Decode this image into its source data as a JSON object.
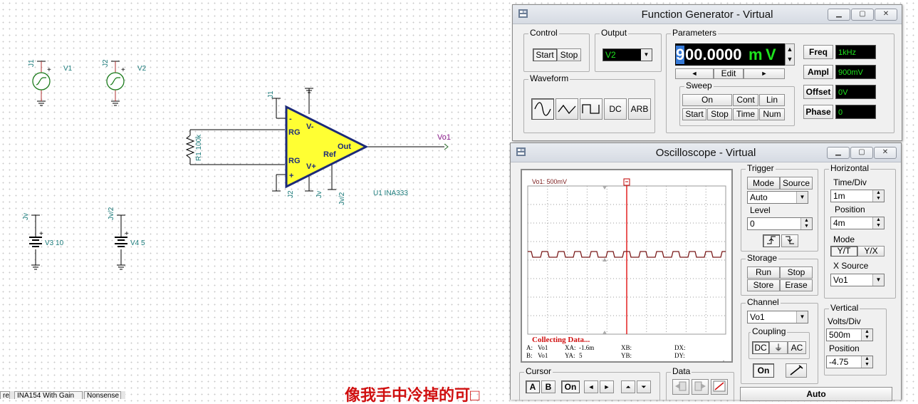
{
  "schematic": {
    "sources": {
      "v1_net": "J1",
      "v1_name": "V1",
      "v2_net": "J2",
      "v2_name": "V2",
      "v3_net": "Jv",
      "v3_name": "V3 10",
      "v4_net": "Jv/2",
      "v4_name": "V4 5"
    },
    "resistor_label": "R1 100k",
    "opamp": {
      "pin_minus": "-",
      "pin_plus": "+",
      "rg_top": "RG",
      "rg_bottom": "RG",
      "vminus": "V-",
      "vplus": "V+",
      "out": "Out",
      "ref": "Ref",
      "top_net": "J1",
      "bottom_net_left": "J2",
      "bottom_net_mid": "Jv",
      "bottom_net_right": "Jv/2",
      "name": "U1 INA333"
    },
    "output_label": "Vo1",
    "plus_sign": "+"
  },
  "function_generator": {
    "title": "Function Generator - Virtual",
    "control_label": "Control",
    "start": "Start",
    "stop": "Stop",
    "output_label": "Output",
    "output_value": "V2",
    "waveform_label": "Waveform",
    "wave_dc": "DC",
    "wave_arb": "ARB",
    "parameters_label": "Parameters",
    "value_first": "9",
    "value_rest": "00.0000",
    "unit_prefix": "m",
    "unit": "V",
    "left_arrow": "◄",
    "edit": "Edit",
    "right_arrow": "►",
    "sweep_label": "Sweep",
    "sweep_on": "On",
    "sweep_cont": "Cont",
    "sweep_lin": "Lin",
    "sweep_start": "Start",
    "sweep_stop": "Stop",
    "sweep_time": "Time",
    "sweep_num": "Num",
    "freq_label": "Freq",
    "freq_value": "1kHz",
    "ampl_label": "Ampl",
    "ampl_value": "900mV",
    "offset_label": "Offset",
    "offset_value": "0V",
    "phase_label": "Phase",
    "phase_value": "0"
  },
  "oscilloscope": {
    "title": "Oscilloscope - Virtual",
    "screen": {
      "channel_label": "Vo1: 500mV",
      "status": "Collecting Data...",
      "a_label": "A:",
      "a_value": "Vo1",
      "xa_label": "XA:",
      "xa_value": "-1.6m",
      "xb_label": "XB:",
      "dx_label": "DX:",
      "b_label": "B:",
      "b_value": "Vo1",
      "ya_label": "YA:",
      "ya_value": "5",
      "yb_label": "YB:",
      "dy_label": "DY:"
    },
    "trigger": {
      "label": "Trigger",
      "mode": "Mode",
      "source": "Source",
      "mode_value": "Auto",
      "level_label": "Level",
      "level_value": "0"
    },
    "horizontal": {
      "label": "Horizontal",
      "timediv_label": "Time/Div",
      "timediv_value": "1m",
      "position_label": "Position",
      "position_value": "4m",
      "mode_label": "Mode",
      "yt": "Y/T",
      "yx": "Y/X",
      "xsource_label": "X Source",
      "xsource_value": "Vo1"
    },
    "storage": {
      "label": "Storage",
      "run": "Run",
      "stop": "Stop",
      "store": "Store",
      "erase": "Erase"
    },
    "channel": {
      "label": "Channel",
      "value": "Vo1",
      "coupling_label": "Coupling",
      "dc": "DC",
      "gnd": "⏚",
      "ac": "AC",
      "on": "On"
    },
    "vertical": {
      "label": "Vertical",
      "voltsdiv_label": "Volts/Div",
      "voltsdiv_value": "500m",
      "position_label": "Position",
      "position_value": "-4.75"
    },
    "cursor": {
      "label": "Cursor",
      "a": "A",
      "b": "B",
      "on": "On",
      "left": "◄",
      "right": "►",
      "up": "⏶",
      "down": "⏷"
    },
    "data_label": "Data",
    "auto": "Auto"
  },
  "bottom_tabs": {
    "tab1": "re",
    "tab2": "INA154 With Gain",
    "tab3": "Nonsense"
  },
  "overlay_text": "像我手中冷掉的可□"
}
